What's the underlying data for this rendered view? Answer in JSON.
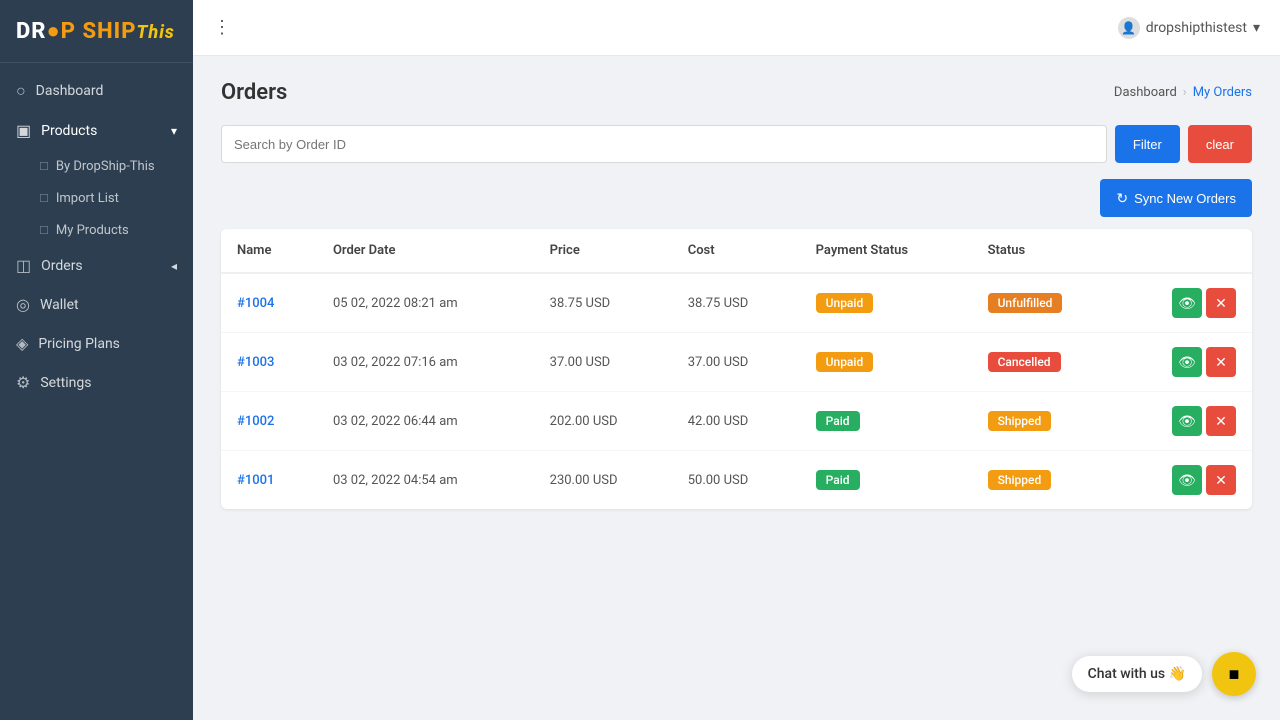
{
  "sidebar": {
    "logo": {
      "drop": "DR",
      "ship": "P SHIP",
      "this": "This"
    },
    "items": [
      {
        "id": "dashboard",
        "label": "Dashboard",
        "icon": "○",
        "active": false
      },
      {
        "id": "products",
        "label": "Products",
        "icon": "▣",
        "active": true,
        "hasChevron": true
      },
      {
        "id": "by-dropship",
        "label": "By DropShip-This",
        "icon": "□",
        "isSub": true
      },
      {
        "id": "import-list",
        "label": "Import List",
        "icon": "□",
        "isSub": true
      },
      {
        "id": "my-products",
        "label": "My Products",
        "icon": "□",
        "isSub": true
      },
      {
        "id": "orders",
        "label": "Orders",
        "icon": "◫",
        "active": false,
        "hasChevron": true
      },
      {
        "id": "wallet",
        "label": "Wallet",
        "icon": "◎",
        "active": false
      },
      {
        "id": "pricing-plans",
        "label": "Pricing Plans",
        "icon": "◈",
        "active": false
      },
      {
        "id": "settings",
        "label": "Settings",
        "icon": "⚙",
        "active": false
      }
    ]
  },
  "topbar": {
    "menu_icon": "⋮",
    "account_name": "dropshipthistest",
    "dropdown_icon": "▾"
  },
  "page": {
    "title": "Orders",
    "breadcrumb": {
      "parent": "Dashboard",
      "current": "My Orders"
    }
  },
  "search": {
    "placeholder": "Search by Order ID",
    "filter_label": "Filter",
    "clear_label": "clear"
  },
  "sync_button": "Sync New Orders",
  "table": {
    "columns": [
      "Name",
      "Order Date",
      "Price",
      "Cost",
      "Payment Status",
      "Status"
    ],
    "rows": [
      {
        "id": "#1004",
        "date": "05 02, 2022 08:21 am",
        "price": "38.75 USD",
        "cost": "38.75 USD",
        "payment_status": "Unpaid",
        "payment_badge": "unpaid",
        "status": "Unfulfilled",
        "status_badge": "unfulfilled"
      },
      {
        "id": "#1003",
        "date": "03 02, 2022 07:16 am",
        "price": "37.00 USD",
        "cost": "37.00 USD",
        "payment_status": "Unpaid",
        "payment_badge": "unpaid",
        "status": "Cancelled",
        "status_badge": "cancelled"
      },
      {
        "id": "#1002",
        "date": "03 02, 2022 06:44 am",
        "price": "202.00 USD",
        "cost": "42.00 USD",
        "payment_status": "Paid",
        "payment_badge": "paid",
        "status": "Shipped",
        "status_badge": "shipped"
      },
      {
        "id": "#1001",
        "date": "03 02, 2022 04:54 am",
        "price": "230.00 USD",
        "cost": "50.00 USD",
        "payment_status": "Paid",
        "payment_badge": "paid",
        "status": "Shipped",
        "status_badge": "shipped"
      }
    ]
  },
  "chat": {
    "label": "Chat with us 👋",
    "icon": "💬"
  }
}
